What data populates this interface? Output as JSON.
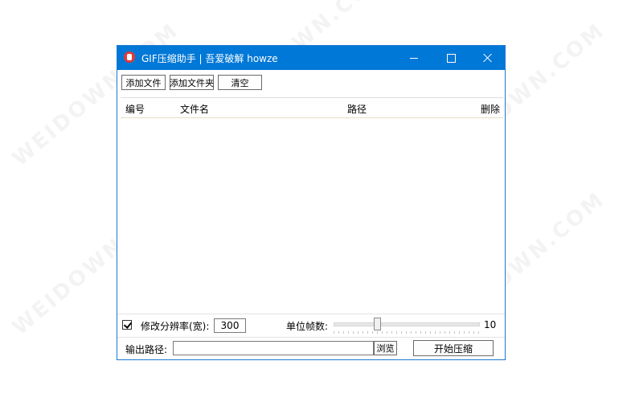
{
  "watermark": "WEIDOWN.COM",
  "window": {
    "title": "GIF压缩助手 | 吾爱破解 howze",
    "accent_color": "#0078d7"
  },
  "toolbar": {
    "add_file": "添加文件",
    "add_folder": "添加文件夹",
    "clear": "清空"
  },
  "list": {
    "columns": [
      "编号",
      "文件名",
      "路径",
      "删除"
    ],
    "rows": []
  },
  "options": {
    "resize_checked": true,
    "resize_label": "修改分辨率(宽):",
    "resize_width": "300",
    "fps_label": "单位帧数:",
    "fps_value": "10"
  },
  "output": {
    "label": "输出路径:",
    "path": "",
    "browse": "浏览",
    "start": "开始压缩"
  }
}
